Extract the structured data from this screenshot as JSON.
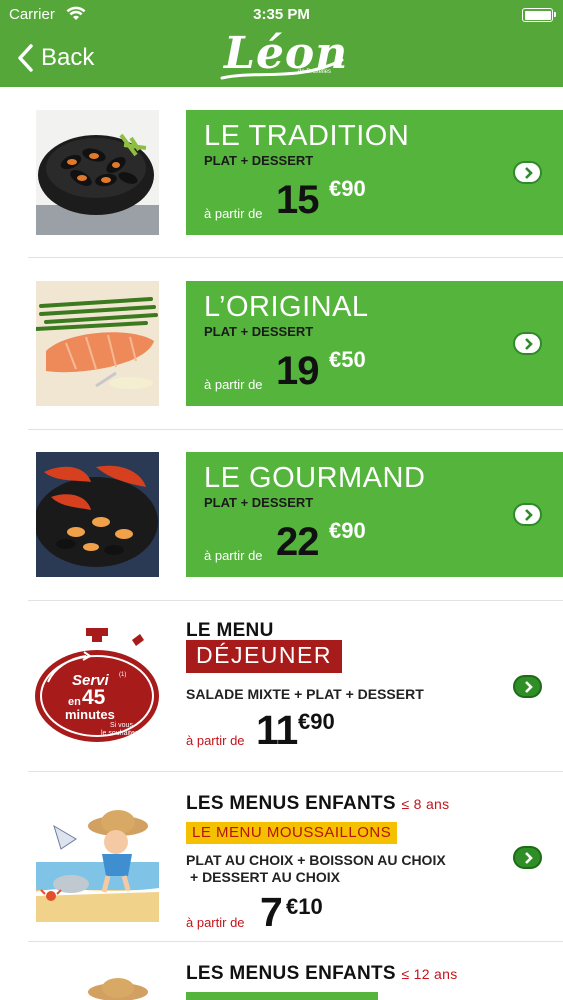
{
  "status_bar": {
    "carrier": "Carrier",
    "time": "3:35 PM"
  },
  "nav": {
    "back_label": "Back",
    "logo_text": "Léon",
    "logo_sub": "de Bruxelles"
  },
  "menus": [
    {
      "title": "LE TRADITION",
      "subtitle": "PLAT + DESSERT",
      "from": "à partir de",
      "price": "15",
      "cents": "€90"
    },
    {
      "title": "L’ORIGINAL",
      "subtitle": "PLAT + DESSERT",
      "from": "à partir de",
      "price": "19",
      "cents": "€50"
    },
    {
      "title": "LE GOURMAND",
      "subtitle": "PLAT + DESSERT",
      "from": "à partir de",
      "price": "22",
      "cents": "€90"
    }
  ],
  "dejeuner": {
    "label": "LE MENU",
    "badge": "DÉJEUNER",
    "desc": "SALADE MIXTE + PLAT + DESSERT",
    "from": "à partir de",
    "price": "11",
    "cents": "€90",
    "clock": {
      "line1": "Servi",
      "sup": "(1)",
      "line2": "en",
      "line3": "45",
      "line4": "minutes",
      "line5": "Si vous",
      "line6": "le souhaitez"
    }
  },
  "enfants": {
    "title": "LES MENUS ENFANTS",
    "age": "≤ 8 ans",
    "badge": "LE MENU MOUSSAILLONS",
    "desc1": "PLAT AU CHOIX + BOISSON AU CHOIX",
    "desc2": "+ DESSERT AU CHOIX",
    "from": "à partir de",
    "price": "7",
    "cents": "€10"
  },
  "enfants2": {
    "title": "LES MENUS ENFANTS",
    "age": "≤ 12 ans"
  },
  "colors": {
    "brand_green": "#55a73a",
    "card_green": "#55b43c",
    "accent_red": "#c3151c",
    "badge_yellow": "#f5c000"
  }
}
